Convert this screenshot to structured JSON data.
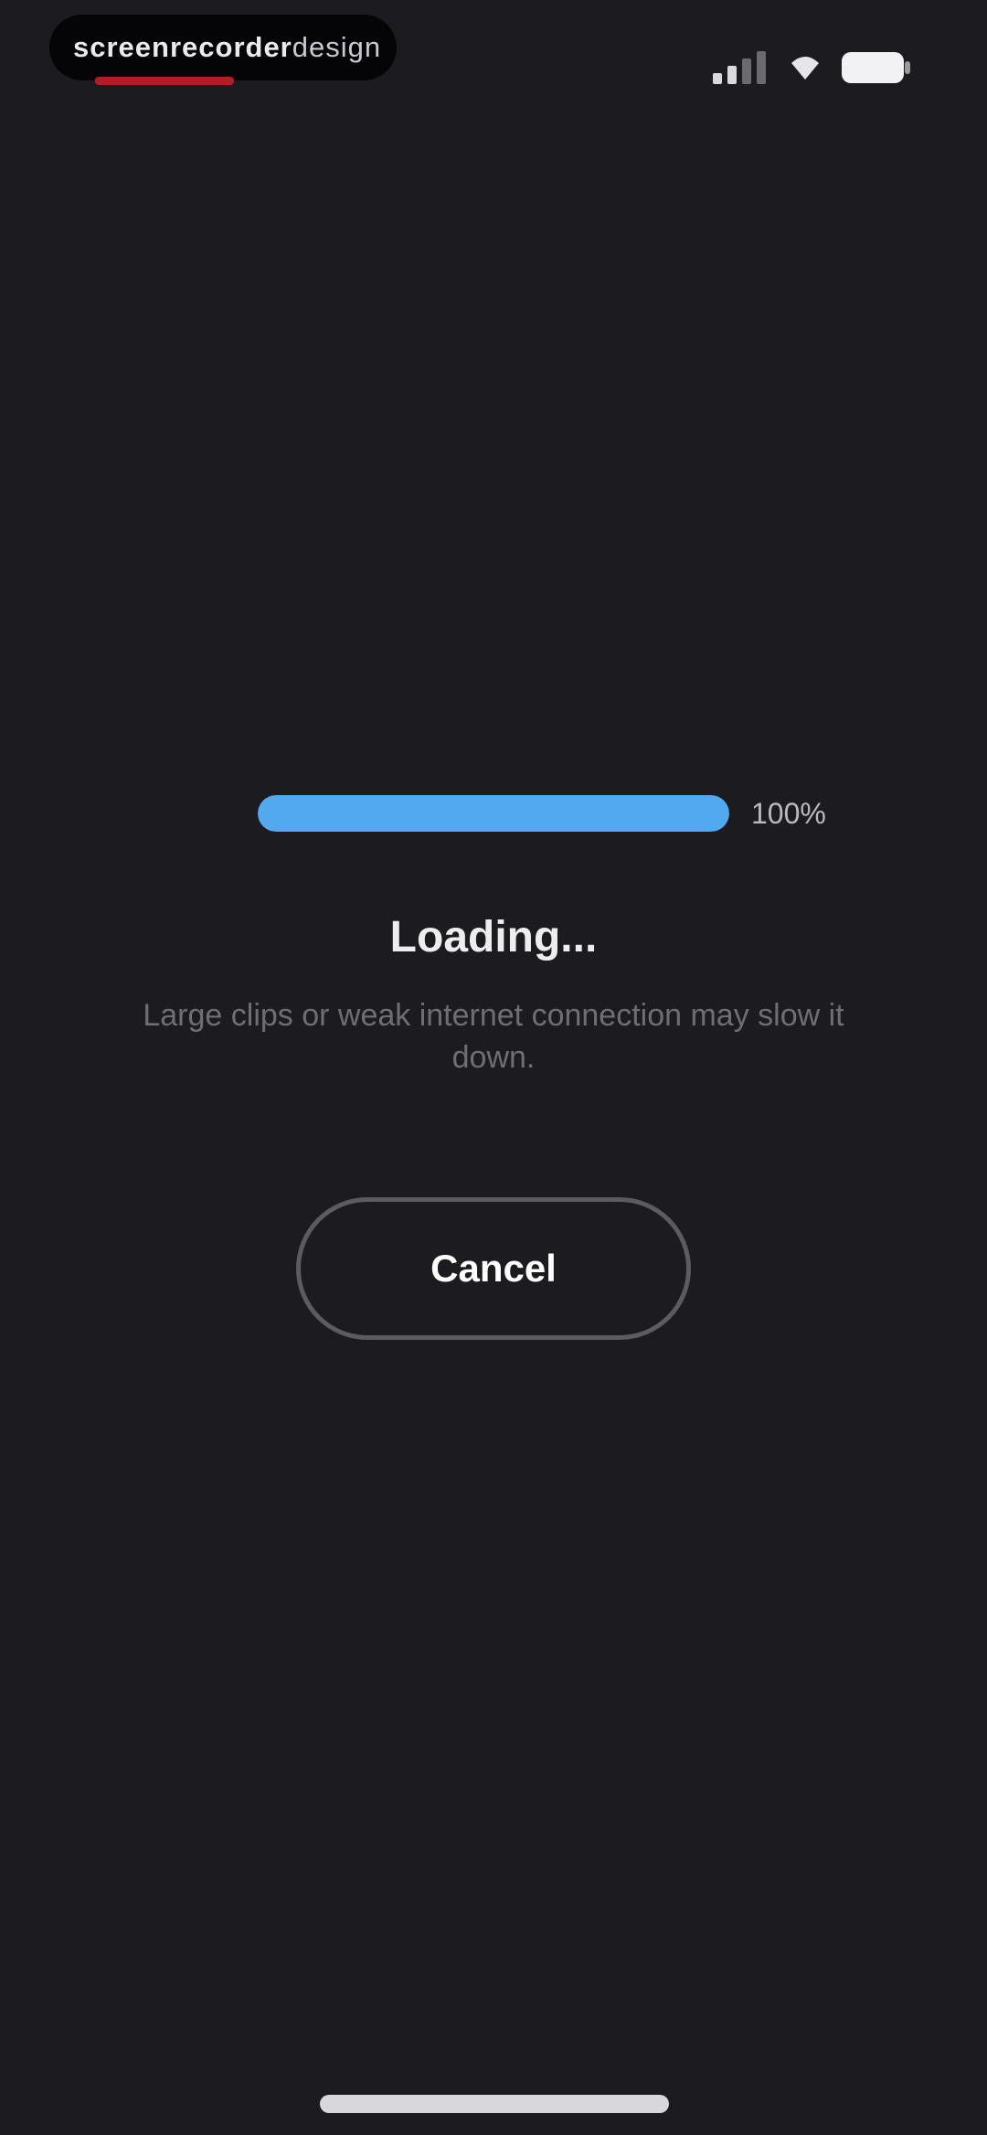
{
  "status_bar": {
    "recording_app": {
      "name_bold": "screenrecorder",
      "name_light": "design",
      "accent_color": "#b51c23"
    },
    "icons": [
      "signal-icon",
      "wifi-icon",
      "battery-icon"
    ]
  },
  "loading": {
    "progress": 1.0,
    "percent_label": "100%",
    "title": "Loading...",
    "subtitle": "Large clips or weak internet connection may slow it down."
  },
  "actions": {
    "cancel_label": "Cancel"
  },
  "colors": {
    "background": "#1c1b20",
    "progress_fill": "#53a9f0",
    "button_border": "#5b5b60"
  }
}
